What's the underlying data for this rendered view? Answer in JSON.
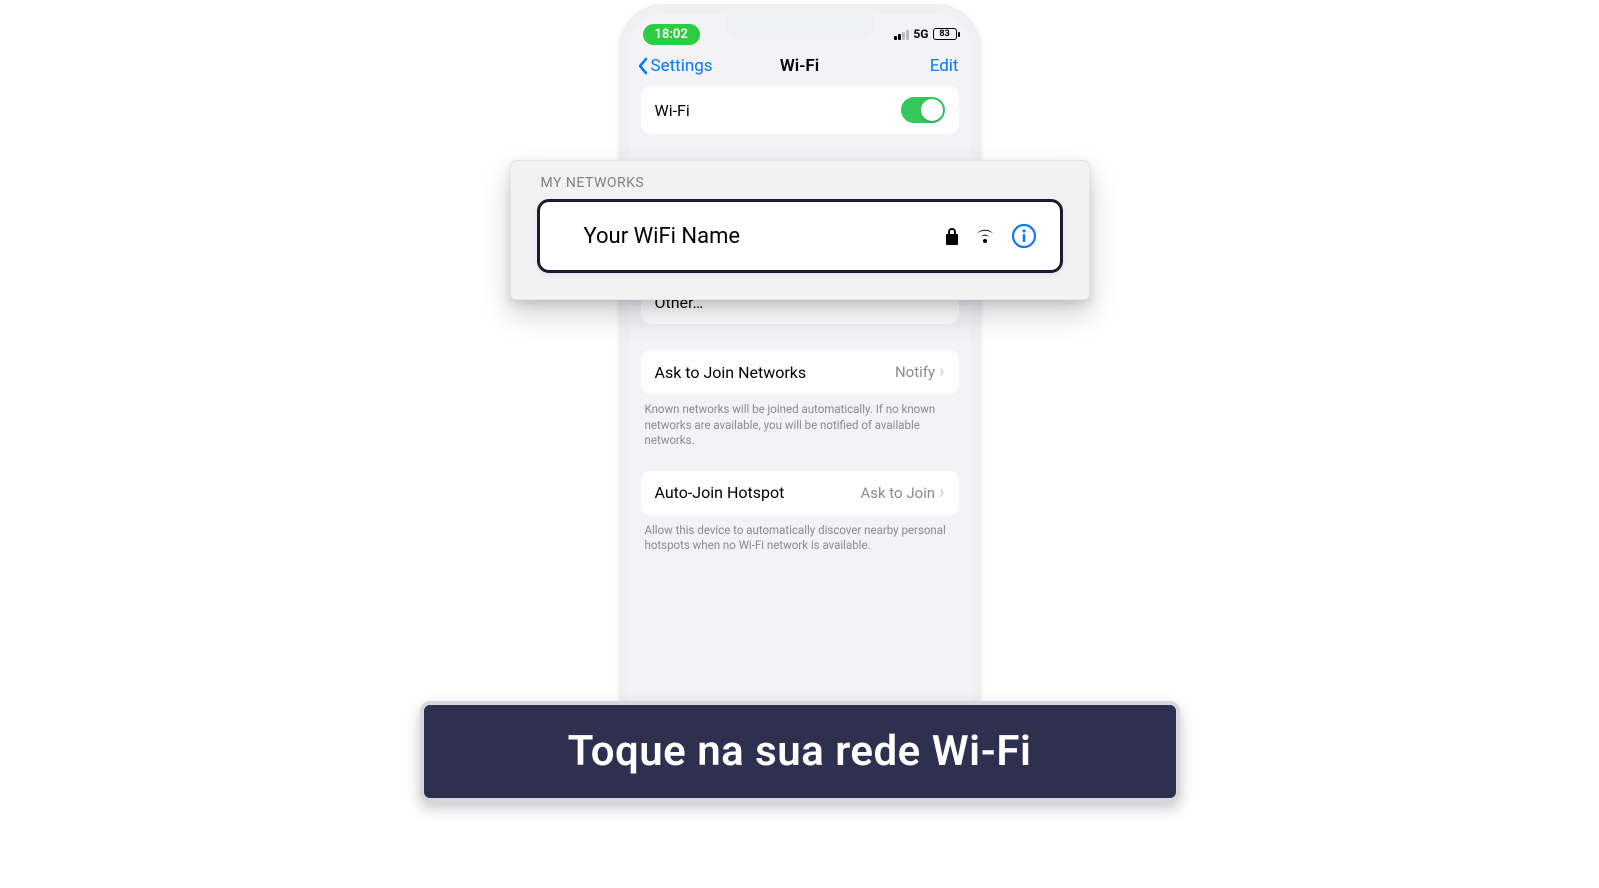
{
  "status": {
    "time": "18:02",
    "net": "5G",
    "battery": "83"
  },
  "nav": {
    "back": "Settings",
    "title": "Wi-Fi",
    "edit": "Edit"
  },
  "wifi_toggle": {
    "label": "Wi-Fi"
  },
  "callout": {
    "section": "MY NETWORKS",
    "name": "Your WiFi Name"
  },
  "other": {
    "label": "Other…"
  },
  "ask": {
    "label": "Ask to Join Networks",
    "value": "Notify",
    "footer": "Known networks will be joined automatically. If no known networks are available, you will be notified of available networks."
  },
  "hotspot": {
    "label": "Auto-Join Hotspot",
    "value": "Ask to Join",
    "footer": "Allow this device to automatically discover nearby personal hotspots when no Wi-Fi network is available."
  },
  "banner": "Toque na sua rede Wi-Fi"
}
